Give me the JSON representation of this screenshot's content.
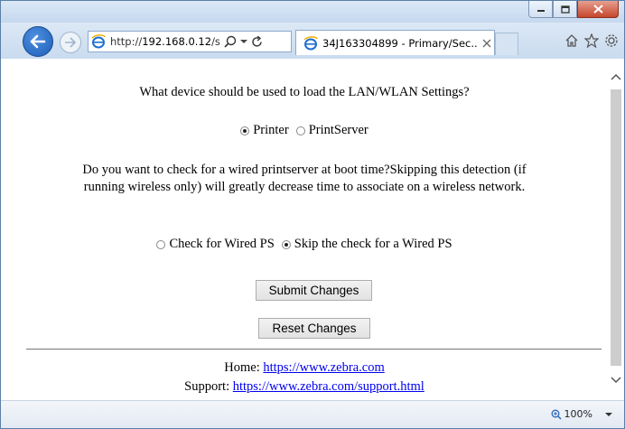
{
  "browser": {
    "address_url_prefix": "http://",
    "address_url_host": "192.168.0.12",
    "address_url_rest": "/setp",
    "tab_title": "34J163304899 - Primary/Sec...",
    "zoom_level": "100%"
  },
  "form": {
    "question_load_settings": "What device should be used to load the LAN/WLAN Settings?",
    "option_printer": "Printer",
    "option_printserver": "PrintServer",
    "selected_load_source": "Printer",
    "question_wired_check": "Do you want to check for a wired printserver at boot time?Skipping this detection (if running wireless only) will greatly decrease time to associate on a wireless network.",
    "option_check_wired": "Check for Wired PS",
    "option_skip_wired": "Skip the check for a Wired PS",
    "selected_wired_option": "Skip the check for a Wired PS",
    "submit_label": "Submit Changes",
    "reset_label": "Reset Changes"
  },
  "footer": {
    "home_label": "Home:",
    "home_link": "https://www.zebra.com",
    "support_label": "Support:",
    "support_link": "https://www.zebra.com/support.html"
  }
}
